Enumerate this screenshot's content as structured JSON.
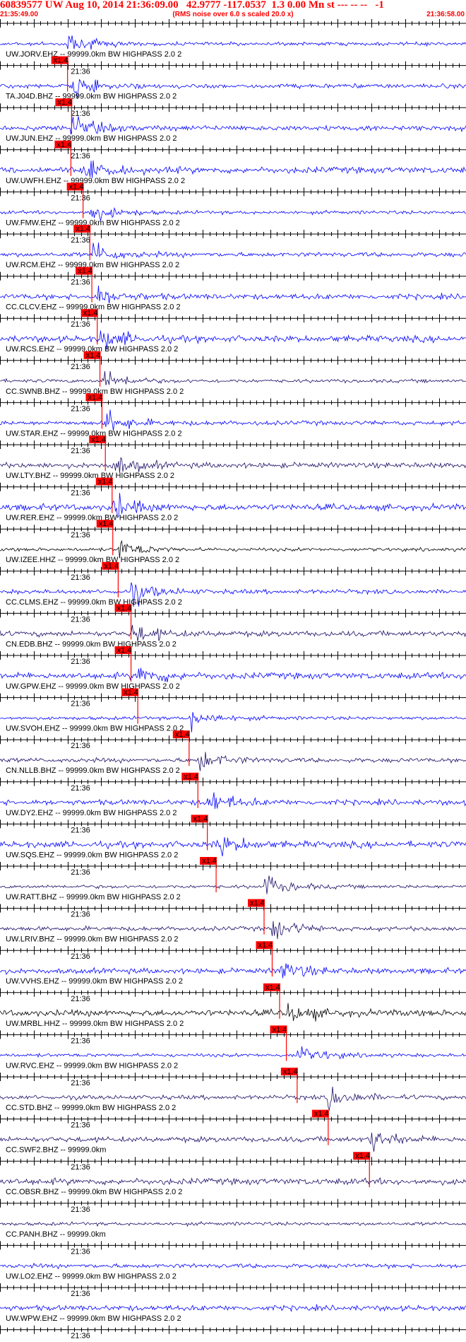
{
  "header": {
    "title": "60839577 UW Aug 10, 2014 21:36:09.00   42.9777 -117.0537  1.3 0.00 Mn st --- -- --   -1",
    "start_time": "21:35:49.00",
    "note": "(RMS noise over 6.0 s scaled 20.0 x)",
    "end_time": "21:36:58.00"
  },
  "chart_data": {
    "type": "line",
    "x_range_s": [
      0,
      69
    ],
    "tick_label": "21:36",
    "tick_label_time_s": 11,
    "pick_marker_label": "x1.4",
    "grid": false,
    "colors": {
      "header": "#ff0000",
      "trace_blue": "#0000ff",
      "trace_navy": "#1a0d66",
      "trace_black": "#000000",
      "pick": "#ff0000",
      "axis": "#000000"
    },
    "traces": [
      {
        "label": "UW.JORV.EHZ -- 99999.0km BW  HIGHPASS  2.0  2",
        "color": "blue",
        "pick_s": 10.0
      },
      {
        "label": "TA.J04D.BHZ -- 99999.0km BW  HIGHPASS  2.0  2",
        "color": "blue",
        "pick_s": 10.6
      },
      {
        "label": "UW.JUN.EHZ -- 99999.0km BW  HIGHPASS  2.0  2",
        "color": "blue",
        "pick_s": 10.5
      },
      {
        "label": "UW.UWFH.EHZ -- 99999.0km BW  HIGHPASS  2.0  2",
        "color": "blue",
        "pick_s": 12.3
      },
      {
        "label": "UW.FMW.EHZ -- 99999.0km BW  HIGHPASS  2.0  2",
        "color": "blue",
        "pick_s": 13.3
      },
      {
        "label": "UW.RCM.EHZ -- 99999.0km BW  HIGHPASS  2.0  2",
        "color": "blue",
        "pick_s": 13.6
      },
      {
        "label": "CC.CLCV.EHZ -- 99999.0km BW  HIGHPASS  2.0  2",
        "color": "blue",
        "pick_s": 14.4
      },
      {
        "label": "UW.RCS.EHZ -- 99999.0km BW  HIGHPASS  2.0  2",
        "color": "blue",
        "pick_s": 14.8
      },
      {
        "label": "CC.SWNB.BHZ -- 99999.0km BW  HIGHPASS  2.0  2",
        "color": "navy",
        "pick_s": 15.1
      },
      {
        "label": "UW.STAR.EHZ -- 99999.0km BW  HIGHPASS  2.0  2",
        "color": "blue",
        "pick_s": 15.6
      },
      {
        "label": "UW.LTY.BHZ -- 99999.0km BW  HIGHPASS  2.0  2",
        "color": "navy",
        "pick_s": 16.6
      },
      {
        "label": "UW.RER.EHZ -- 99999.0km BW  HIGHPASS  2.0  2",
        "color": "blue",
        "pick_s": 16.7
      },
      {
        "label": "UW.IZEE.HHZ -- 99999.0km BW  HIGHPASS  2.0  2",
        "color": "black",
        "pick_s": 17.5
      },
      {
        "label": "CC.CLMS.EHZ -- 99999.0km BW  HIGHPASS  2.0  2",
        "color": "blue",
        "pick_s": 19.4
      },
      {
        "label": "CN.EDB.BHZ -- 99999.0km BW  HIGHPASS  2.0  2",
        "color": "navy",
        "pick_s": 19.4
      },
      {
        "label": "UW.GPW.EHZ -- 99999.0km BW  HIGHPASS  2.0  2",
        "color": "blue",
        "pick_s": 20.4
      },
      {
        "label": "UW.SVOH.EHZ -- 99999.0km BW  HIGHPASS  2.0  2",
        "color": "blue",
        "pick_s": 28.0
      },
      {
        "label": "CN.NLLB.BHZ -- 99999.0km BW  HIGHPASS  2.0  2",
        "color": "navy",
        "pick_s": 29.3
      },
      {
        "label": "UW.DY2.EHZ -- 99999.0km BW  HIGHPASS  2.0  2",
        "color": "blue",
        "pick_s": 30.7
      },
      {
        "label": "UW.SQS.EHZ -- 99999.0km BW  HIGHPASS  2.0  2",
        "color": "blue",
        "pick_s": 32.0
      },
      {
        "label": "UW.RATT.BHZ -- 99999.0km BW  HIGHPASS  2.0  2",
        "color": "navy",
        "pick_s": 39.1
      },
      {
        "label": "UW.LRIV.BHZ -- 99999.0km BW  HIGHPASS  2.0  2",
        "color": "navy",
        "pick_s": 40.3
      },
      {
        "label": "UW.VVHS.EHZ -- 99999.0km BW  HIGHPASS  2.0  2",
        "color": "blue",
        "pick_s": 41.4
      },
      {
        "label": "UW.MRBL.HHZ -- 99999.0km BW  HIGHPASS  2.0  2",
        "color": "black",
        "pick_s": 42.4
      },
      {
        "label": "UW.RVC.EHZ -- 99999.0km BW  HIGHPASS  2.0  2",
        "color": "blue",
        "pick_s": 44.0
      },
      {
        "label": "CC.STD.BHZ -- 99999.0km BW  HIGHPASS  2.0  2",
        "color": "navy",
        "pick_s": 48.6
      },
      {
        "label": "CC.SWF2.BHZ -- 99999.0km",
        "color": "navy",
        "pick_s": 54.7
      },
      {
        "label": "CC.OBSR.BHZ -- 99999.0km BW  HIGHPASS  2.0  2",
        "color": "navy",
        "pick_s": null
      },
      {
        "label": "CC.PANH.BHZ -- 99999.0km",
        "color": "navy",
        "pick_s": null
      },
      {
        "label": "UW.LO2.EHZ -- 99999.0km BW  HIGHPASS  2.0  2",
        "color": "blue",
        "pick_s": null
      },
      {
        "label": "UW.WPW.EHZ -- 99999.0km BW  HIGHPASS  2.0  2",
        "color": "blue",
        "pick_s": null
      }
    ]
  }
}
